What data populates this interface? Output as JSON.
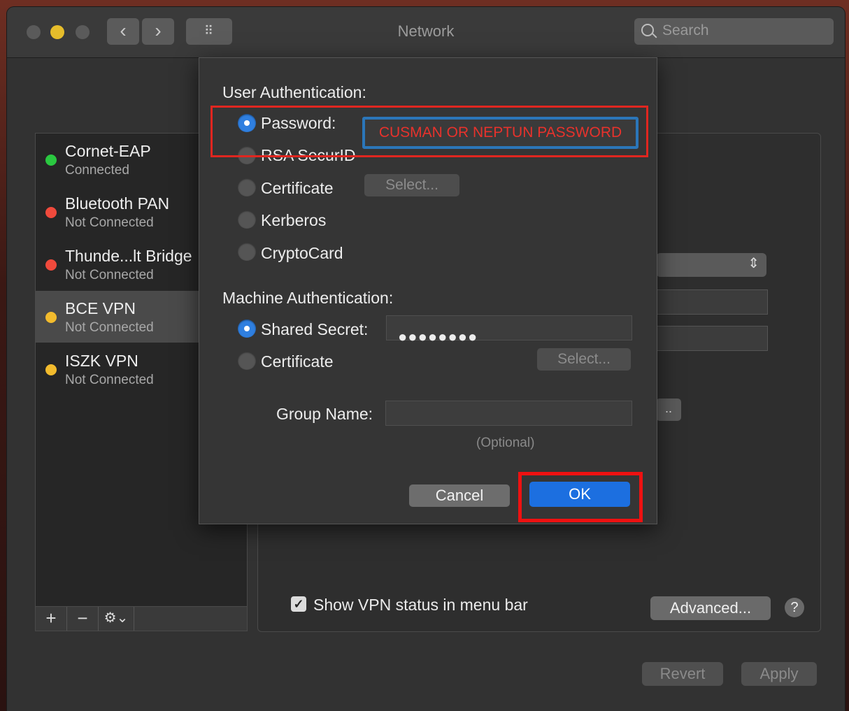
{
  "window": {
    "title": "Network",
    "search_placeholder": "Search"
  },
  "nav": {
    "back_icon": "‹",
    "forward_icon": "›",
    "grid_icon": "⠿"
  },
  "sidebar": {
    "items": [
      {
        "name": "Cornet-EAP",
        "status": "Connected",
        "dot_color": "#2ac840"
      },
      {
        "name": "Bluetooth PAN",
        "status": "Not Connected",
        "dot_color": "#f04a3c"
      },
      {
        "name": "Thunde...lt Bridge",
        "status": "Not Connected",
        "dot_color": "#f04a3c"
      },
      {
        "name": "BCE VPN",
        "status": "Not Connected",
        "dot_color": "#f2bb2d"
      },
      {
        "name": "ISZK VPN",
        "status": "Not Connected",
        "dot_color": "#f2bb2d"
      }
    ],
    "toolbar": {
      "add": "+",
      "remove": "−",
      "gear": "⚙⌄"
    }
  },
  "panel": {
    "show_vpn_status_label": "Show VPN status in menu bar",
    "show_vpn_status_checked": true,
    "advanced_label": "Advanced...",
    "help_label": "?",
    "revert_label": "Revert",
    "apply_label": "Apply"
  },
  "dialog": {
    "user_auth_title": "User Authentication:",
    "user_auth_options": [
      "Password:",
      "RSA SecurID",
      "Certificate",
      "Kerberos",
      "CryptoCard"
    ],
    "user_auth_selected": "Password:",
    "password_value": "CUSMAN OR NEPTUN PASSWORD",
    "certificate_select_label": "Select...",
    "machine_auth_title": "Machine Authentication:",
    "machine_auth_options": [
      "Shared Secret:",
      "Certificate"
    ],
    "machine_auth_selected": "Shared Secret:",
    "shared_secret_value": "●●●●●●●●",
    "machine_certificate_select_label": "Select...",
    "group_name_label": "Group Name:",
    "group_name_value": "",
    "group_name_hint": "(Optional)",
    "cancel_label": "Cancel",
    "ok_label": "OK"
  }
}
